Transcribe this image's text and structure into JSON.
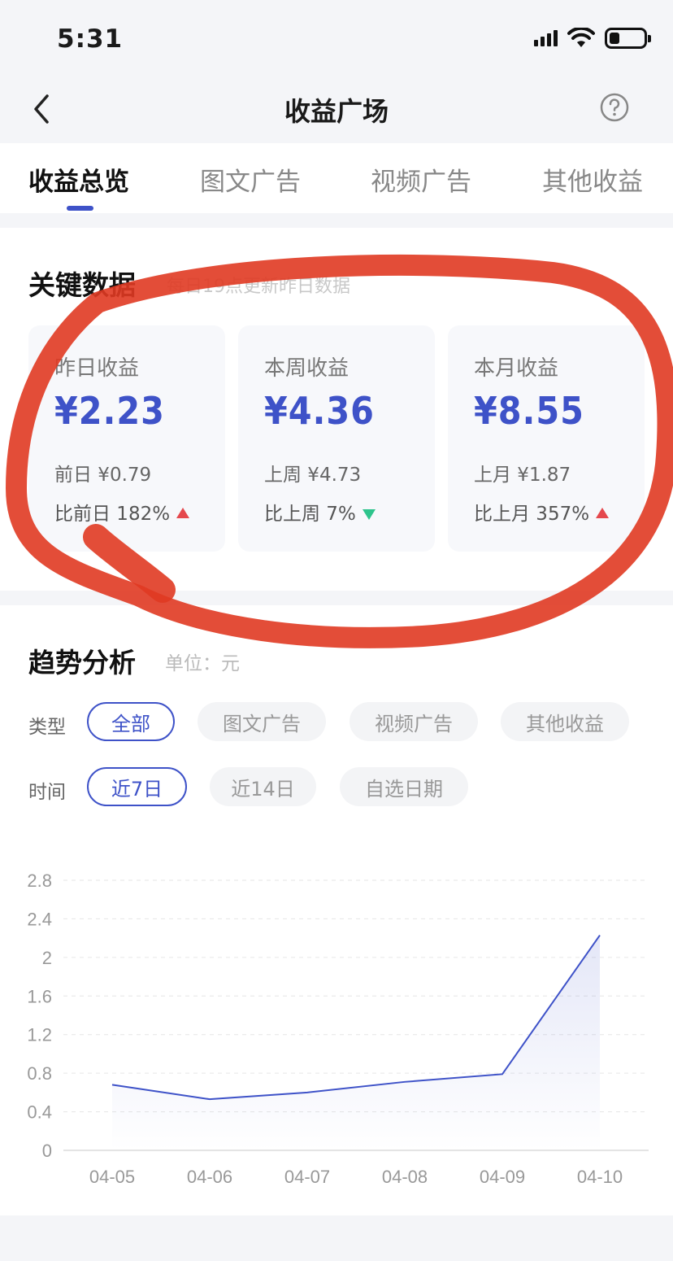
{
  "status": {
    "time": "5:31"
  },
  "nav": {
    "title": "收益广场"
  },
  "tabs": [
    {
      "label": "收益总览",
      "active": true
    },
    {
      "label": "图文广告",
      "active": false
    },
    {
      "label": "视频广告",
      "active": false
    },
    {
      "label": "其他收益",
      "active": false
    }
  ],
  "key_data": {
    "title": "关键数据",
    "subtitle": "每日19点更新昨日数据",
    "cards": [
      {
        "label": "昨日收益",
        "value": "¥2.23",
        "prev": "前日 ¥0.79",
        "cmp": "比前日 182%",
        "trend": "up"
      },
      {
        "label": "本周收益",
        "value": "¥4.36",
        "prev": "上周 ¥4.73",
        "cmp": "比上周 7%",
        "trend": "down"
      },
      {
        "label": "本月收益",
        "value": "¥8.55",
        "prev": "上月 ¥1.87",
        "cmp": "比上月 357%",
        "trend": "up"
      }
    ]
  },
  "trend": {
    "title": "趋势分析",
    "unit": "单位：元",
    "type_label": "类型",
    "type_options": [
      "全部",
      "图文广告",
      "视频广告",
      "其他收益"
    ],
    "type_selected": "全部",
    "time_label": "时间",
    "time_options": [
      "近7日",
      "近14日",
      "自选日期"
    ],
    "time_selected": "近7日"
  },
  "colors": {
    "accent": "#3e52c8",
    "up": "#e5484d",
    "down": "#2ec48c",
    "annotation": "#e03a22"
  },
  "chart_data": {
    "type": "area",
    "x": [
      "04-05",
      "04-06",
      "04-07",
      "04-08",
      "04-09",
      "04-10"
    ],
    "values": [
      0.68,
      0.53,
      0.6,
      0.71,
      0.79,
      2.23
    ],
    "yticks": [
      "2.8",
      "2.4",
      "2",
      "1.6",
      "1.2",
      "0.8",
      "0.4",
      "0"
    ],
    "ylim": [
      0,
      2.8
    ],
    "grid": true,
    "color": "#3e52c8"
  }
}
